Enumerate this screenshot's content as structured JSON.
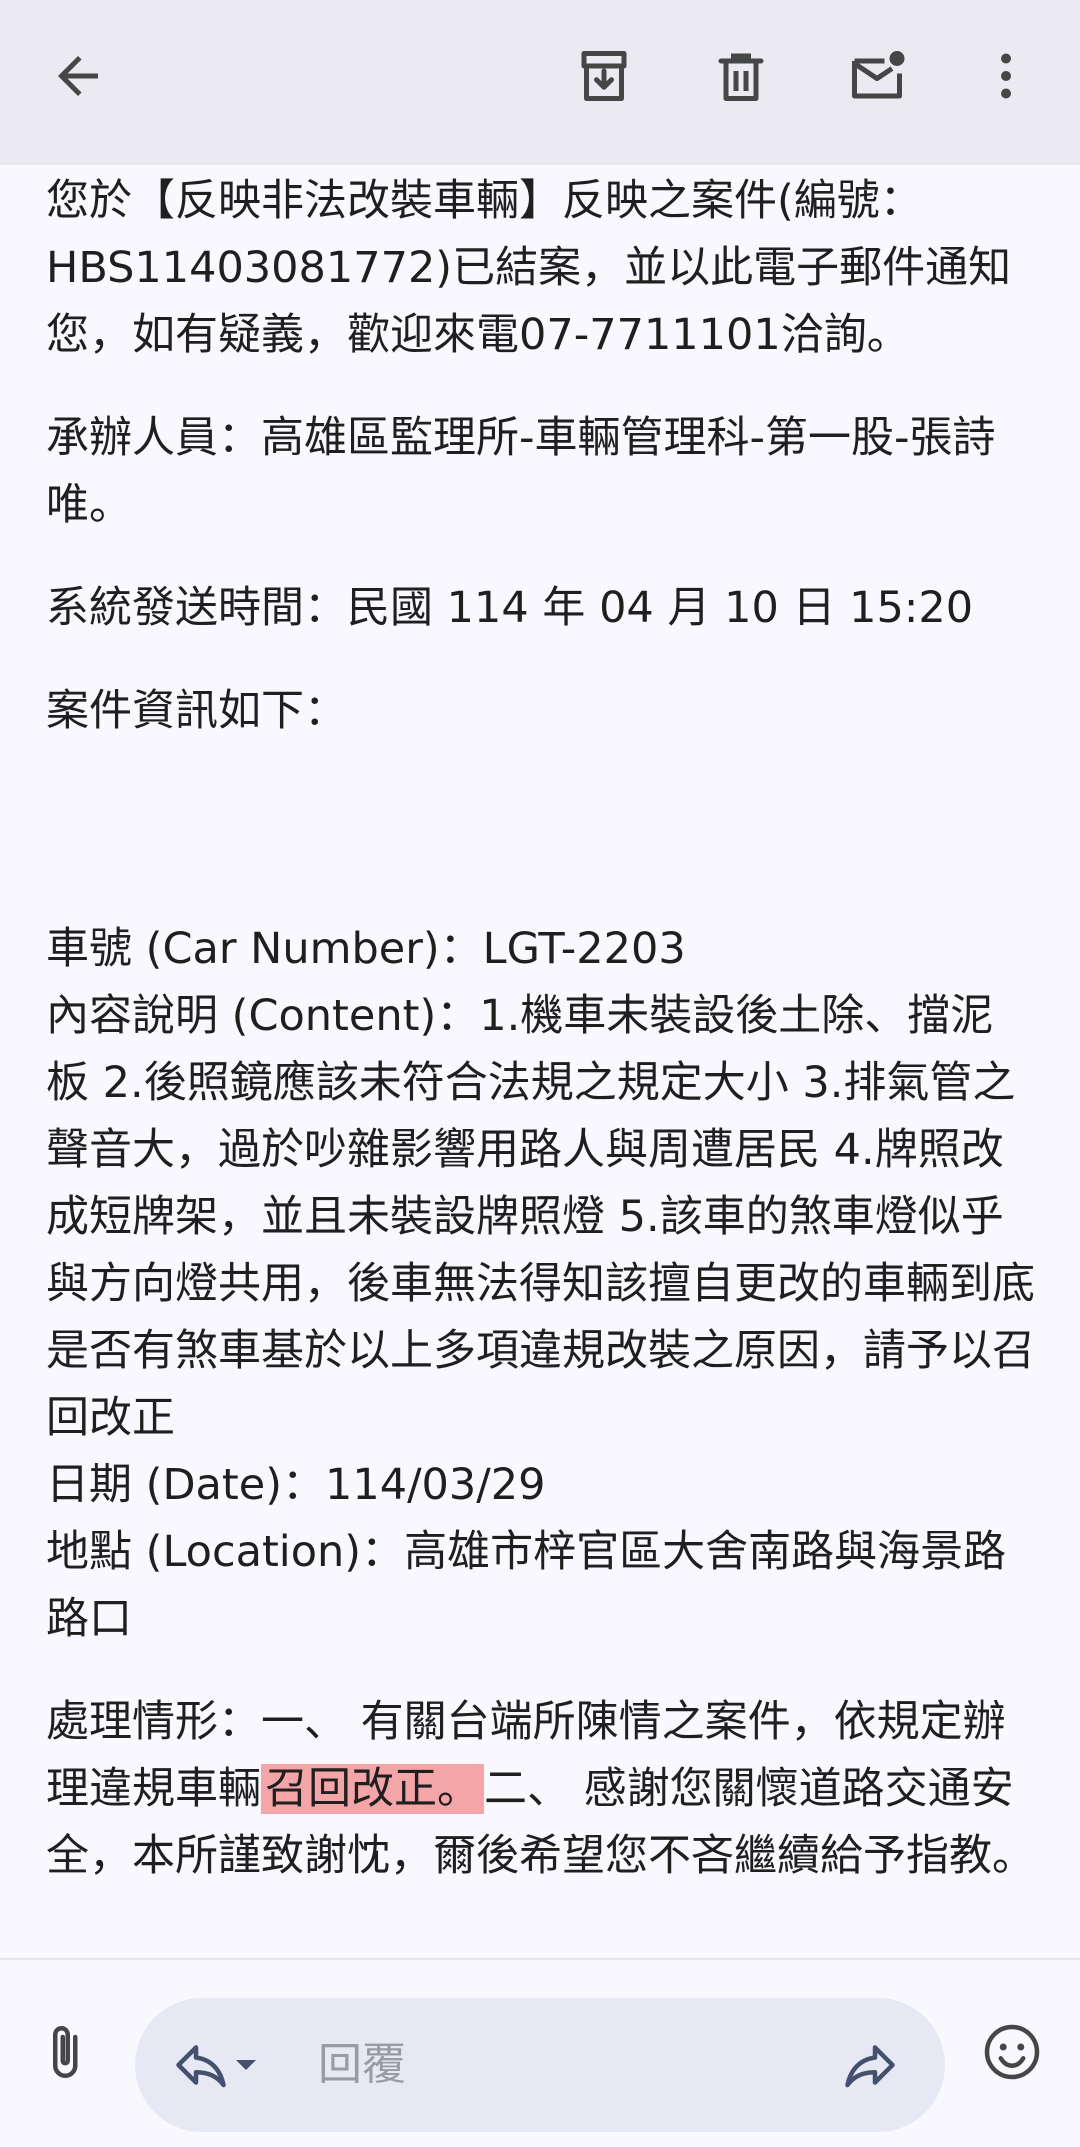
{
  "toolbar": {
    "back_icon": "arrow-left-icon",
    "archive_icon": "archive-icon",
    "delete_icon": "trash-icon",
    "mark_unread_icon": "mail-unread-icon",
    "more_icon": "more-vert-icon"
  },
  "email": {
    "intro": "您於【反映非法改裝車輛】反映之案件(編號：HBS11403081772)已結案，並以此電子郵件通知您，如有疑義，歡迎來電07-7711101洽詢。",
    "handler": "承辦人員：高雄區監理所-車輛管理科-第一股-張詩唯。",
    "sent_time": "系統發送時間：民國 114 年 04 月 10 日 15:20",
    "case_info_heading": "案件資訊如下：",
    "car_number": "車號 (Car Number)：LGT-2203",
    "content": "內容說明 (Content)：1.機車未裝設後土除、擋泥板 2.後照鏡應該未符合法規之規定大小 3.排氣管之聲音大，過於吵雜影響用路人與周遭居民 4.牌照改成短牌架，並且未裝設牌照燈 5.該車的煞車燈似乎與方向燈共用，後車無法得知該擅自更改的車輛到底是否有煞車基於以上多項違規改裝之原因，請予以召回改正",
    "date": "日期 (Date)：114/03/29",
    "location": "地點 (Location)：高雄市梓官區大舍南路與海景路路口",
    "handling_before": "處理情形：一、 有關台端所陳情之案件，依規定辦理違規車輛",
    "handling_highlight": "召回改正。",
    "handling_after": "二、 感謝您關懷道路交通安全，本所謹致謝忱，爾後希望您不吝繼續給予指教。"
  },
  "reply_bar": {
    "attach_icon": "paperclip-icon",
    "reply_icon": "reply-icon",
    "dropdown_icon": "caret-down-icon",
    "placeholder": "回覆",
    "forward_icon": "forward-icon",
    "emoji_icon": "emoji-icon"
  },
  "colors": {
    "topbar_bg": "#eceaf1",
    "page_bg": "#f9f8fe",
    "highlight": "#f4a5a8",
    "reply_pill_bg": "#e6e8f3"
  }
}
